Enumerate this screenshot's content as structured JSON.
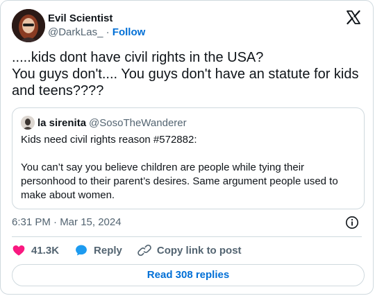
{
  "author": {
    "display_name": "Evil Scientist",
    "handle": "@DarkLas_",
    "separator": "·",
    "follow_label": "Follow"
  },
  "tweet": {
    "text": ".....kids dont have civil rights in the USA?\nYou guys don't.... You guys don't have an statute for kids and teens????"
  },
  "quote": {
    "name": "la sirenita",
    "handle": "@SosoTheWanderer",
    "text": "Kids need civil rights reason #572882:\n\nYou can’t say you believe children are people while tying their personhood to their parent’s desires. Same argument people used to make about women."
  },
  "meta": {
    "timestamp": "6:31 PM · Mar 15, 2024"
  },
  "actions": {
    "likes": "41.3K",
    "reply_label": "Reply",
    "copy_label": "Copy link to post"
  },
  "read_replies_label": "Read 308 replies",
  "icons": {
    "brand": "x-logo-icon",
    "info": "info-icon",
    "like": "heart-icon",
    "reply": "speech-bubble-icon",
    "copy": "link-icon"
  },
  "colors": {
    "accent": "#006fd6",
    "like": "#f91880",
    "reply": "#1d9bf0",
    "muted": "#536471",
    "border": "#cfd9de"
  }
}
